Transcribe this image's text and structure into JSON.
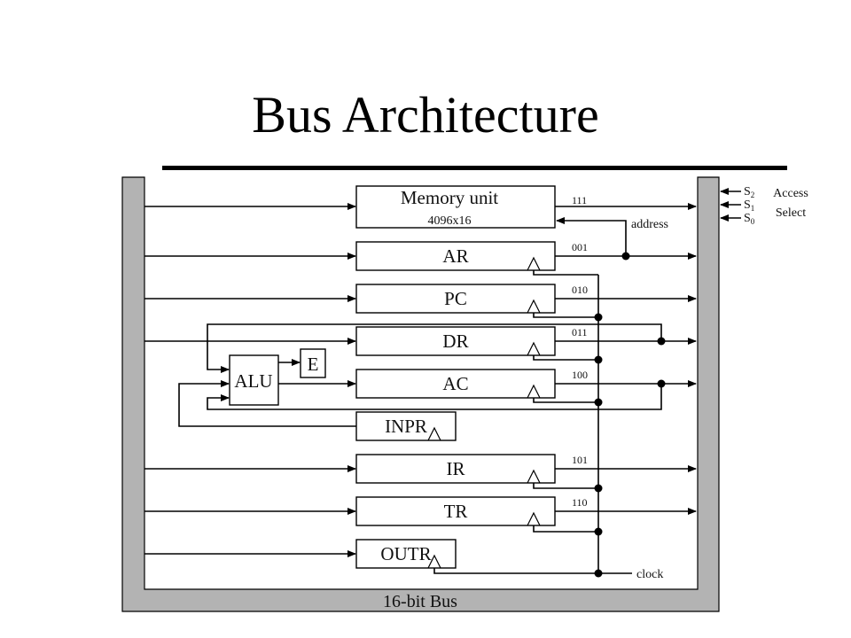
{
  "title": "Bus Architecture",
  "bus": {
    "label": "16-bit Bus",
    "fill_color": "#b3b3b3"
  },
  "select_inputs": {
    "signals": [
      {
        "name": "S",
        "sub": "2"
      },
      {
        "name": "S",
        "sub": "1"
      },
      {
        "name": "S",
        "sub": "0"
      }
    ],
    "caption_line1": "Access",
    "caption_line2": "Select"
  },
  "memory": {
    "label": "Memory unit",
    "size": "4096x16",
    "select_code": "111",
    "address_label": "address"
  },
  "registers": [
    {
      "id": "ar",
      "label": "AR",
      "select_code": "001"
    },
    {
      "id": "pc",
      "label": "PC",
      "select_code": "010"
    },
    {
      "id": "dr",
      "label": "DR",
      "select_code": "011"
    },
    {
      "id": "ac",
      "label": "AC",
      "select_code": "100"
    },
    {
      "id": "inpr",
      "label": "INPR",
      "select_code": ""
    },
    {
      "id": "ir",
      "label": "IR",
      "select_code": "101"
    },
    {
      "id": "tr",
      "label": "TR",
      "select_code": "110"
    },
    {
      "id": "outr",
      "label": "OUTR",
      "select_code": ""
    }
  ],
  "alu": {
    "label": "ALU"
  },
  "e_flag": {
    "label": "E"
  },
  "clock_label": "clock"
}
